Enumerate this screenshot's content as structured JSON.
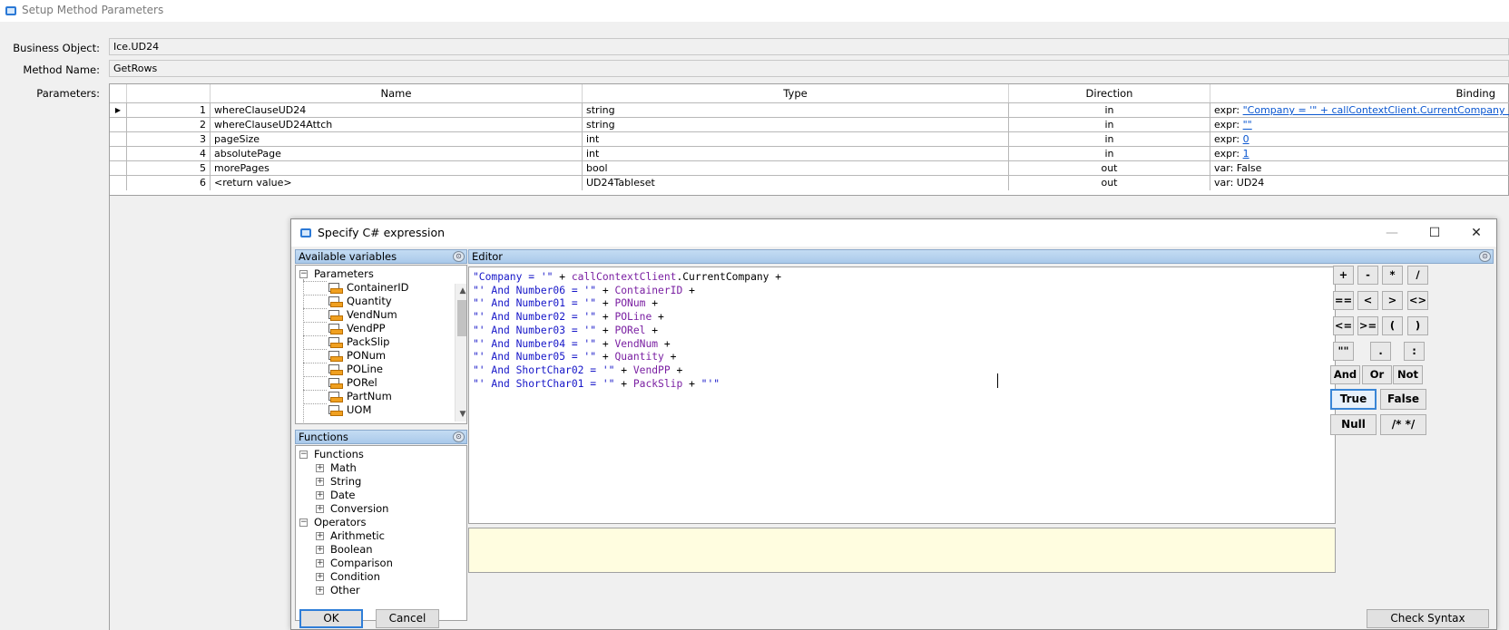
{
  "window": {
    "title": "Setup Method Parameters"
  },
  "form": {
    "business_object_label": "Business Object:",
    "business_object_value": "Ice.UD24",
    "method_name_label": "Method Name:",
    "method_name_value": "GetRows",
    "parameters_label": "Parameters:"
  },
  "grid": {
    "headers": {
      "name": "Name",
      "type": "Type",
      "direction": "Direction",
      "binding": "Binding"
    },
    "rows": [
      {
        "num": "1",
        "name": "whereClauseUD24",
        "type": "string",
        "direction": "in",
        "binding_prefix": "expr: ",
        "binding_value": "\"Company = '\" + callContextClient.CurrentCompany +..."
      },
      {
        "num": "2",
        "name": "whereClauseUD24Attch",
        "type": "string",
        "direction": "in",
        "binding_prefix": "expr: ",
        "binding_value": "\"\""
      },
      {
        "num": "3",
        "name": "pageSize",
        "type": "int",
        "direction": "in",
        "binding_prefix": "expr: ",
        "binding_value": "0"
      },
      {
        "num": "4",
        "name": "absolutePage",
        "type": "int",
        "direction": "in",
        "binding_prefix": "expr: ",
        "binding_value": "1"
      },
      {
        "num": "5",
        "name": "morePages",
        "type": "bool",
        "direction": "out",
        "binding_prefix": "var: False",
        "binding_value": ""
      },
      {
        "num": "6",
        "name": "<return value>",
        "type": "UD24Tableset",
        "direction": "out",
        "binding_prefix": "var: UD24",
        "binding_value": ""
      }
    ]
  },
  "dialog": {
    "title": "Specify C# expression",
    "minimize": "—",
    "maximize": "☐",
    "close": "✕",
    "available_variables": {
      "header": "Available variables",
      "root": "Parameters",
      "items": [
        "ContainerID",
        "Quantity",
        "VendNum",
        "VendPP",
        "PackSlip",
        "PONum",
        "POLine",
        "PORel",
        "PartNum",
        "UOM"
      ]
    },
    "functions": {
      "header": "Functions",
      "groups": [
        {
          "label": "Functions",
          "children": [
            "Math",
            "String",
            "Date",
            "Conversion"
          ]
        },
        {
          "label": "Operators",
          "children": [
            "Arithmetic",
            "Boolean",
            "Comparison",
            "Condition",
            "Other"
          ]
        }
      ]
    },
    "editor": {
      "header": "Editor",
      "lines": [
        [
          [
            "s",
            "\"Company = '\""
          ],
          [
            "p",
            " + "
          ],
          [
            "v",
            "callContextClient"
          ],
          [
            "p",
            ".CurrentCompany +"
          ]
        ],
        [
          [
            "s",
            "\"' And Number06 = '\""
          ],
          [
            "p",
            " + "
          ],
          [
            "v",
            "ContainerID"
          ],
          [
            "p",
            " +"
          ]
        ],
        [
          [
            "s",
            "\"' And Number01 = '\""
          ],
          [
            "p",
            " + "
          ],
          [
            "v",
            "PONum"
          ],
          [
            "p",
            " +"
          ]
        ],
        [
          [
            "s",
            "\"' And Number02 = '\""
          ],
          [
            "p",
            " + "
          ],
          [
            "v",
            "POLine"
          ],
          [
            "p",
            " +"
          ]
        ],
        [
          [
            "s",
            "\"' And Number03 = '\""
          ],
          [
            "p",
            " + "
          ],
          [
            "v",
            "PORel"
          ],
          [
            "p",
            " +"
          ]
        ],
        [
          [
            "s",
            "\"' And Number04 = '\""
          ],
          [
            "p",
            " + "
          ],
          [
            "v",
            "VendNum"
          ],
          [
            "p",
            " +"
          ]
        ],
        [
          [
            "s",
            "\"' And Number05 = '\""
          ],
          [
            "p",
            " + "
          ],
          [
            "v",
            "Quantity"
          ],
          [
            "p",
            " +"
          ]
        ],
        [
          [
            "s",
            "\"' And ShortChar02 = '\""
          ],
          [
            "p",
            " + "
          ],
          [
            "v",
            "VendPP"
          ],
          [
            "p",
            " +"
          ]
        ],
        [
          [
            "s",
            "\"' And ShortChar01 = '\""
          ],
          [
            "p",
            " + "
          ],
          [
            "v",
            "PackSlip"
          ],
          [
            "p",
            " + "
          ],
          [
            "s",
            "\"'\""
          ]
        ]
      ]
    },
    "keypad": {
      "row1": [
        "+",
        "-",
        "*",
        "/"
      ],
      "row2": [
        "==",
        "<",
        ">",
        "<>"
      ],
      "row3": [
        "<=",
        ">=",
        "(",
        ")"
      ],
      "row4": [
        "\"\"",
        ".",
        ":"
      ],
      "row5": [
        "And",
        "Or",
        "Not"
      ],
      "row6": [
        "True",
        "False"
      ],
      "row7": [
        "Null",
        "/* */"
      ]
    },
    "buttons": {
      "ok": "OK",
      "cancel": "Cancel",
      "check_syntax": "Check Syntax"
    }
  }
}
